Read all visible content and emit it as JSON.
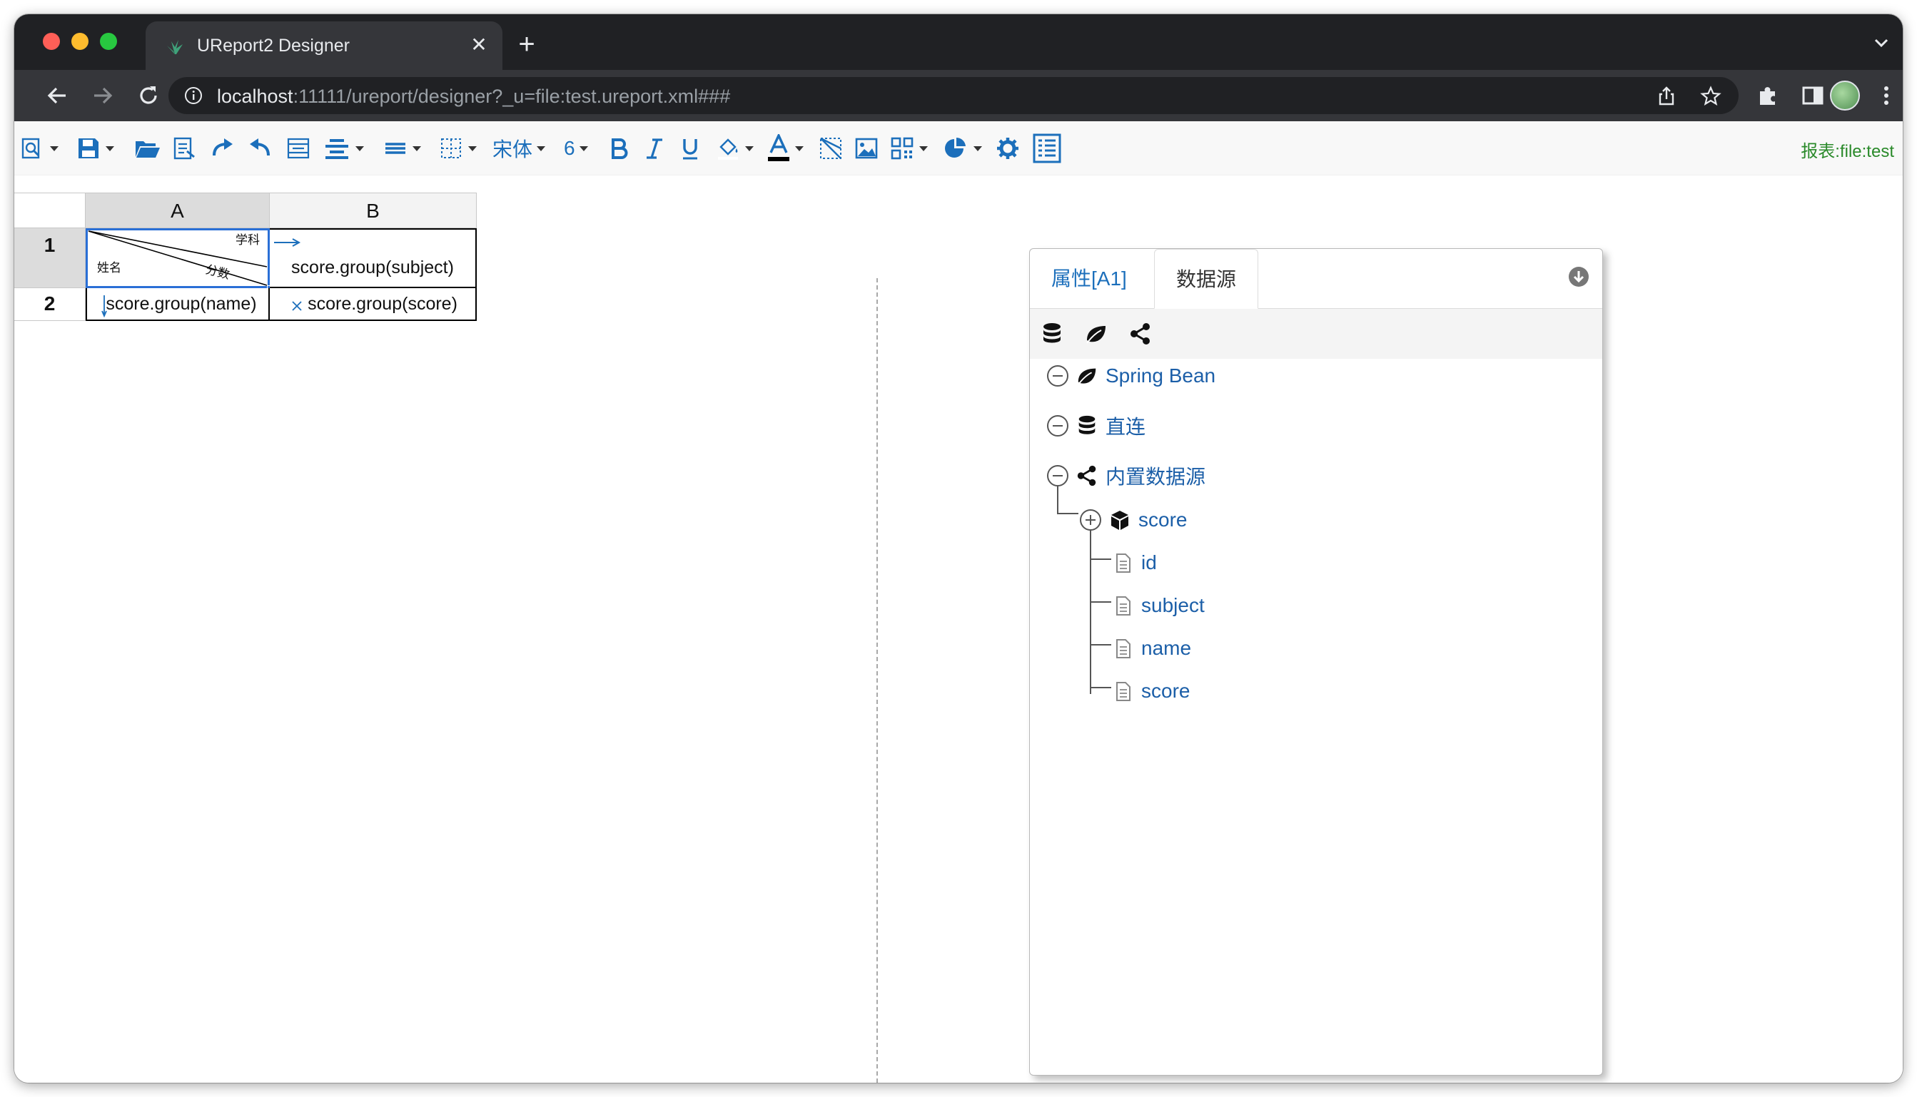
{
  "browser": {
    "tab_title": "UReport2 Designer",
    "url_host": "localhost",
    "url_rest": ":11111/ureport/designer?_u=file:test.ureport.xml###"
  },
  "toolbar": {
    "font_name": "宋体",
    "font_size": "6",
    "report_name": "报表:file:test"
  },
  "grid": {
    "columns": [
      "A",
      "B"
    ],
    "rows": [
      "1",
      "2"
    ],
    "cells": {
      "a1_slash_top": "学科",
      "a1_slash_left": "姓名",
      "a1_slash_bottom": "分数",
      "b1": "score.group(subject)",
      "a2": "score.group(name)",
      "b2": "score.group(score)"
    }
  },
  "panel": {
    "tabs": [
      "属性[A1]",
      "数据源"
    ],
    "active_tab": "数据源",
    "tree": {
      "spring_bean": "Spring Bean",
      "direct": "直连",
      "builtin": "内置数据源",
      "dataset": "score",
      "fields": [
        "id",
        "subject",
        "name",
        "score"
      ]
    }
  },
  "colors": {
    "accent_blue": "#1c6fbb",
    "report_name_green": "#2a8a2a",
    "tree_link": "#1c5fa8"
  }
}
